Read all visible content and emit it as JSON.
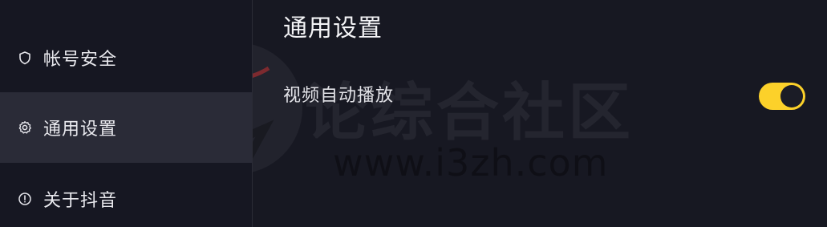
{
  "sidebar": {
    "items": [
      {
        "label": "帐号安全",
        "icon": "shield-icon"
      },
      {
        "label": "通用设置",
        "icon": "gear-icon",
        "active": true
      },
      {
        "label": "关于抖音",
        "icon": "info-icon"
      }
    ]
  },
  "main": {
    "title": "通用设置",
    "settings": [
      {
        "label": "视频自动播放",
        "enabled": true
      }
    ]
  },
  "watermark": {
    "text": "论综合社区",
    "url": "www.i3zh.com"
  },
  "colors": {
    "background": "#171822",
    "active_item": "#2a2b37",
    "toggle_on": "#fcd12a"
  }
}
